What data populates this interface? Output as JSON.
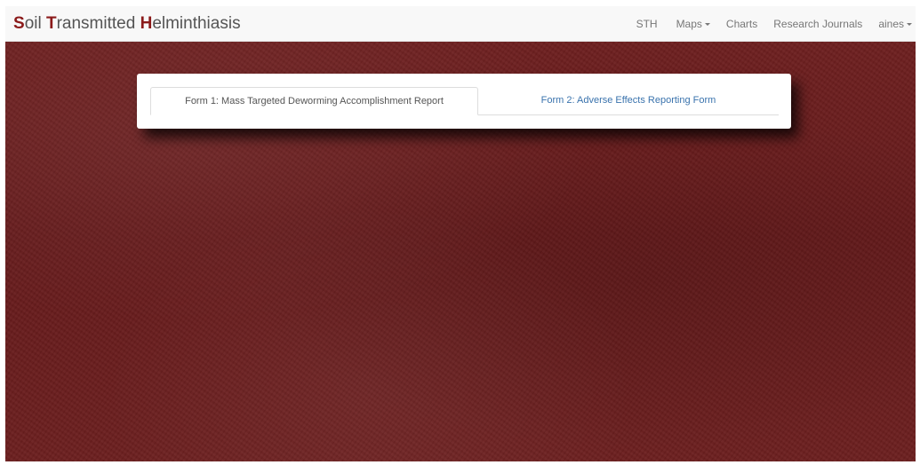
{
  "navbar": {
    "brand": {
      "parts": [
        {
          "text": "S",
          "highlight": true
        },
        {
          "text": "oil ",
          "highlight": false
        },
        {
          "text": "T",
          "highlight": true
        },
        {
          "text": "ransmitted ",
          "highlight": false
        },
        {
          "text": "H",
          "highlight": true
        },
        {
          "text": "elminthiasis",
          "highlight": false
        }
      ]
    },
    "items": [
      {
        "label": "STH",
        "dropdown": false
      },
      {
        "label": "Maps",
        "dropdown": true
      },
      {
        "label": "Charts",
        "dropdown": false
      },
      {
        "label": "Research Journals",
        "dropdown": false
      },
      {
        "label": "aines",
        "dropdown": true
      }
    ]
  },
  "tabs": [
    {
      "label": "Form 1: Mass Targeted Deworming Accomplishment Report",
      "active": true
    },
    {
      "label": "Form 2: Adverse Effects Reporting Form",
      "active": false
    }
  ],
  "colors": {
    "background": "#6b1d1d",
    "brand_highlight": "#8b1a1a",
    "link": "#3a73ad"
  }
}
